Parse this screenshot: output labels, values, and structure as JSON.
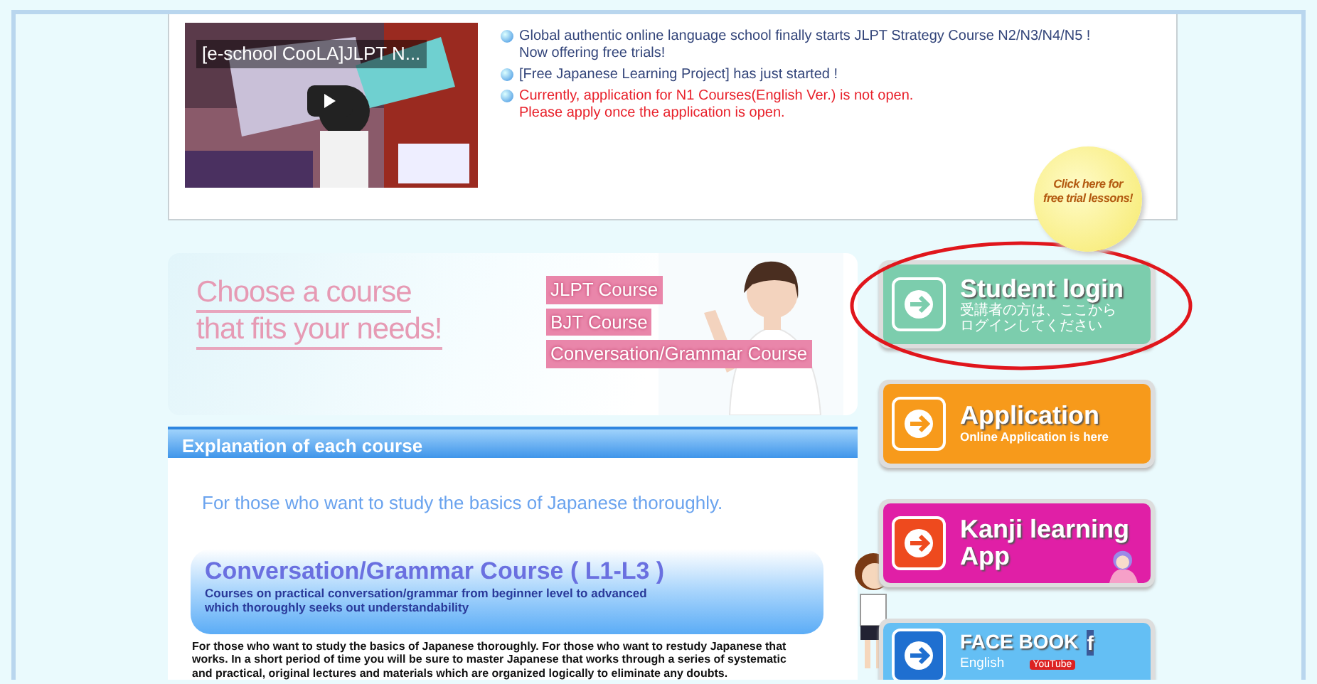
{
  "video": {
    "title": "[e-school CooLA]JLPT N..."
  },
  "news": [
    {
      "kind": "normal",
      "lines": [
        "Global authentic online language school finally starts JLPT Strategy Course N2/N3/N4/N5 !",
        "Now offering free trials!"
      ]
    },
    {
      "kind": "normal",
      "lines": [
        "[Free Japanese Learning Project] has just started !"
      ]
    },
    {
      "kind": "alert",
      "lines": [
        "Currently, application for N1 Courses(English Ver.) is not open.",
        "Please apply once the application is open."
      ]
    }
  ],
  "trial_badge": {
    "lines": [
      "Click here for",
      "free trial lessons!"
    ]
  },
  "banner": {
    "heading_lines": [
      "Choose a course",
      "that fits your needs!"
    ],
    "links": [
      "JLPT Course",
      "BJT Course",
      "Conversation/Grammar Course"
    ]
  },
  "section_title": "Explanation of each course",
  "intro": "For those who want to study the basics of Japanese thoroughly.",
  "course": {
    "title": "Conversation/Grammar Course ( L1-L3 )",
    "subtitle_lines": [
      "Courses on practical conversation/grammar from beginner level to advanced",
      "which thoroughly seeks out understandability"
    ],
    "description": "For those who want to study the basics of Japanese thoroughly. For those who want to restudy Japanese that works.  In a short period of time you will be sure to master Japanese that works through a series of systematic and practical, original lectures and materials which are organized logically to eliminate any doubts."
  },
  "side_buttons": [
    {
      "kind": "login",
      "highlighted": true,
      "title_lines": [
        "Student login"
      ],
      "subtitle_lines": [
        "受講者の方は、ここから",
        "ログインしてください"
      ]
    },
    {
      "kind": "application",
      "highlighted": false,
      "title_lines": [
        "Application"
      ],
      "subtitle_lines": [
        "Online Application is here"
      ]
    },
    {
      "kind": "kanji",
      "highlighted": false,
      "title_lines": [
        "Kanji learning",
        "App"
      ]
    },
    {
      "kind": "social",
      "highlighted": false,
      "title_lines": [
        "FACE BOOK"
      ],
      "icon_text": "f",
      "subtitle_lines": [
        "English"
      ],
      "badge": "YouTube"
    }
  ]
}
